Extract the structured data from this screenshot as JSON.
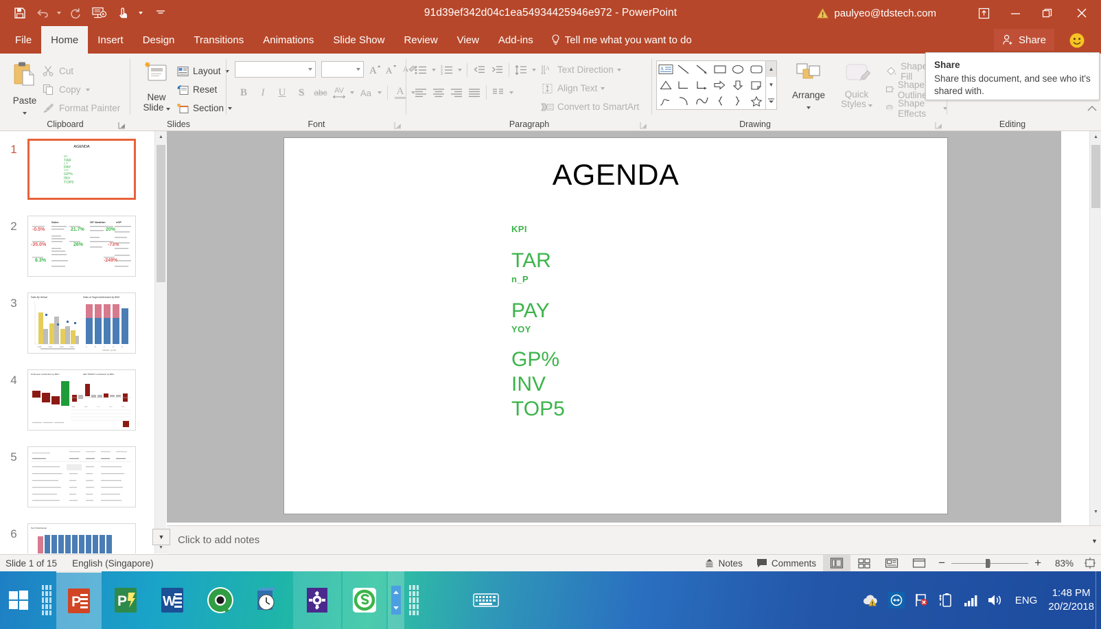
{
  "window": {
    "title": "91d39ef342d04c1ea54934425946e972  -  PowerPoint",
    "account": "paulyeo@tdstech.com",
    "quick_access": [
      "save-icon",
      "undo-icon",
      "redo-icon",
      "start-presentation-icon",
      "touch-mode-icon",
      "customize-qat-icon"
    ],
    "controls": [
      "ribbon-display-options-icon",
      "minimize-icon",
      "restore-icon",
      "close-icon"
    ]
  },
  "tabs": [
    {
      "label": "File",
      "active": false
    },
    {
      "label": "Home",
      "active": true
    },
    {
      "label": "Insert",
      "active": false
    },
    {
      "label": "Design",
      "active": false
    },
    {
      "label": "Transitions",
      "active": false
    },
    {
      "label": "Animations",
      "active": false
    },
    {
      "label": "Slide Show",
      "active": false
    },
    {
      "label": "Review",
      "active": false
    },
    {
      "label": "View",
      "active": false
    },
    {
      "label": "Add-ins",
      "active": false
    }
  ],
  "tell_me": "Tell me what you want to do",
  "share_button": "Share",
  "tooltip": {
    "title": "Share",
    "body": "Share this document, and see who it's shared with."
  },
  "ribbon": {
    "groups": [
      {
        "label": "Clipboard"
      },
      {
        "label": "Slides"
      },
      {
        "label": "Font"
      },
      {
        "label": "Paragraph"
      },
      {
        "label": "Drawing"
      },
      {
        "label": "Editing"
      }
    ],
    "clipboard": {
      "paste": "Paste",
      "cut": "Cut",
      "copy": "Copy",
      "format_painter": "Format Painter"
    },
    "slides": {
      "new_slide": "New\nSlide",
      "new_slide_line1": "New",
      "new_slide_line2": "Slide",
      "layout": "Layout",
      "reset": "Reset",
      "section": "Section"
    },
    "font": {
      "font_name_value": "",
      "font_name_placeholder": "",
      "font_size_value": "",
      "font_size_placeholder": "",
      "bold": "B",
      "italic": "I",
      "underline": "U",
      "shadow": "S",
      "strikethrough": "abc",
      "character_spacing": "AV",
      "change_case": "Aa",
      "font_color": "A"
    },
    "paragraph": {
      "text_direction": "Text Direction",
      "align_text": "Align Text",
      "convert_to_smartart": "Convert to SmartArt"
    },
    "drawing": {
      "arrange": "Arrange",
      "quick_styles_line1": "Quick",
      "quick_styles_line2": "Styles",
      "shape_fill": "Shape Fill",
      "shape_outline": "Shape Outline",
      "shape_effects": "Shape Effects"
    }
  },
  "thumbnails": [
    {
      "number": "1",
      "selected": true
    },
    {
      "number": "2",
      "selected": false
    },
    {
      "number": "3",
      "selected": false
    },
    {
      "number": "4",
      "selected": false
    },
    {
      "number": "5",
      "selected": false
    },
    {
      "number": "6",
      "selected": false
    }
  ],
  "slide": {
    "title": "AGENDA",
    "accent_color": "#3cb44a",
    "items": [
      {
        "text": "KPI",
        "size": "small"
      },
      {
        "text": "TAR",
        "size": "large"
      },
      {
        "text": "n_P",
        "size": "small"
      },
      {
        "text": "PAY",
        "size": "large"
      },
      {
        "text": "YOY",
        "size": "small"
      },
      {
        "text": "GP%",
        "size": "large"
      },
      {
        "text": "INV",
        "size": "large"
      },
      {
        "text": "TOP5",
        "size": "large"
      }
    ]
  },
  "notes": {
    "placeholder": "Click to add notes"
  },
  "status": {
    "slide_count": "Slide 1 of 15",
    "language": "English (Singapore)",
    "notes_label": "Notes",
    "comments_label": "Comments",
    "views": [
      "normal-view-icon",
      "slide-sorter-icon",
      "reading-view-icon",
      "slide-show-icon"
    ],
    "zoom_out": "−",
    "zoom_in": "+",
    "zoom_percent": "83%",
    "fit_to_window": "fit-slide-icon"
  },
  "taskbar": {
    "start": "windows-start-icon",
    "apps": [
      "powerpoint-icon",
      "publisher-icon",
      "word-icon",
      "qlikview-icon",
      "clock-icon",
      "settings-icon",
      "skype-icon"
    ],
    "tray_icons": [
      "onedrive-warning-icon",
      "teamviewer-icon",
      "action-center-flag-icon",
      "battery-icon",
      "network-icon",
      "volume-icon"
    ],
    "language": "ENG",
    "time": "1:48 PM",
    "date": "20/2/2018"
  }
}
